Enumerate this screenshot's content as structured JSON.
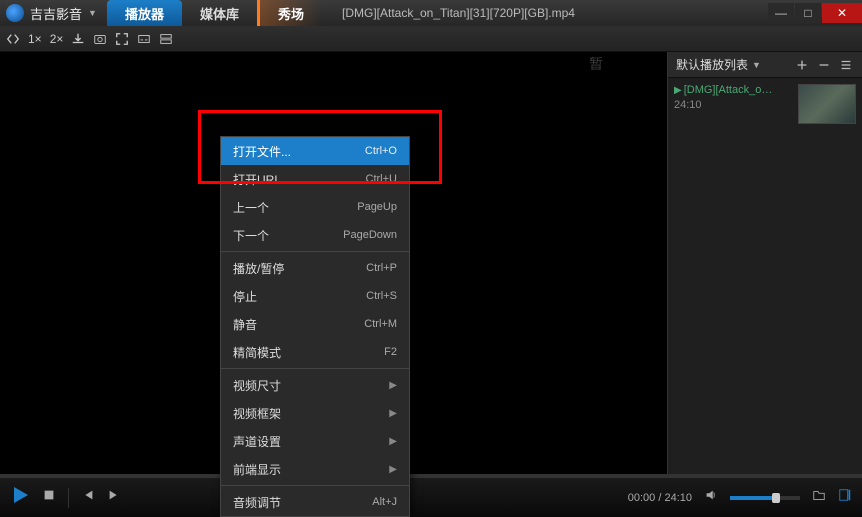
{
  "app": {
    "name": "吉吉影音"
  },
  "tabs": {
    "player": "播放器",
    "library": "媒体库",
    "show": "秀场"
  },
  "file_title": "[DMG][Attack_on_Titan][31][720P][GB].mp4",
  "toolbar": {
    "speed1": "1×",
    "speed2": "2×"
  },
  "watermark": "暂",
  "playlist": {
    "title": "默认播放列表",
    "items": [
      {
        "name": "[DMG][Attack_o…",
        "duration": "24:10"
      }
    ]
  },
  "context_menu": [
    {
      "label": "打开文件...",
      "shortcut": "Ctrl+O",
      "hl": true
    },
    {
      "label": "打开URL...",
      "shortcut": "Ctrl+U"
    },
    {
      "label": "上一个",
      "shortcut": "PageUp"
    },
    {
      "label": "下一个",
      "shortcut": "PageDown"
    },
    {
      "sep": true
    },
    {
      "label": "播放/暂停",
      "shortcut": "Ctrl+P"
    },
    {
      "label": "停止",
      "shortcut": "Ctrl+S"
    },
    {
      "label": "静音",
      "shortcut": "Ctrl+M"
    },
    {
      "label": "精简模式",
      "shortcut": "F2"
    },
    {
      "sep": true
    },
    {
      "label": "视频尺寸",
      "sub": true
    },
    {
      "label": "视频框架",
      "sub": true
    },
    {
      "label": "声道设置",
      "sub": true
    },
    {
      "label": "前端显示",
      "sub": true
    },
    {
      "sep": true
    },
    {
      "label": "音频调节",
      "shortcut": "Alt+J"
    }
  ],
  "time": {
    "current": "00:00",
    "total": "24:10"
  }
}
